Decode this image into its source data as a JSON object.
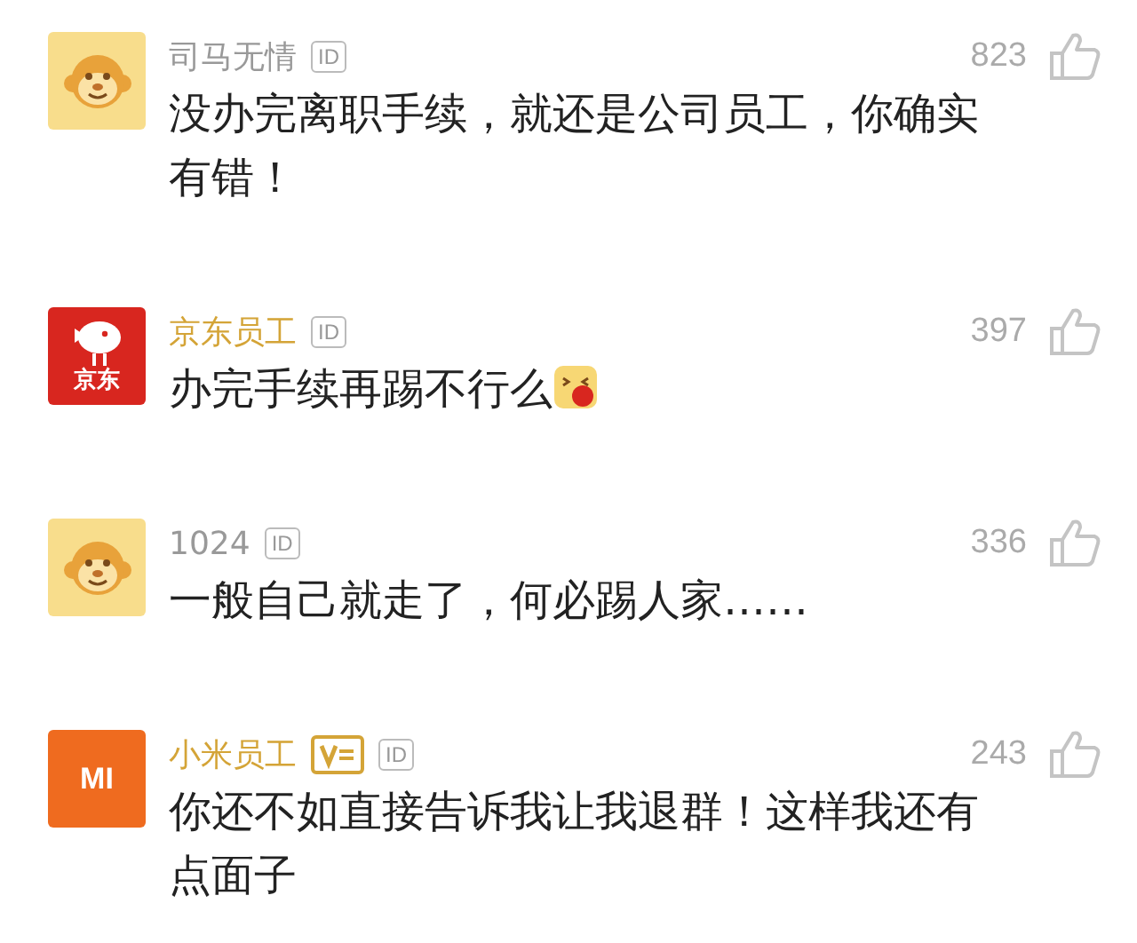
{
  "comments": [
    {
      "avatar": {
        "kind": "monkey"
      },
      "name": "司马无情",
      "highlighted": false,
      "vip": false,
      "id_badge": "ID",
      "likes": "823",
      "text": "没办完离职手续，就还是公司员工，你确实有错！",
      "emoji": false
    },
    {
      "avatar": {
        "kind": "jd",
        "text": "京东"
      },
      "name": "京东员工",
      "highlighted": true,
      "vip": false,
      "id_badge": "ID",
      "likes": "397",
      "text": "办完手续再踢不行么",
      "emoji": true
    },
    {
      "avatar": {
        "kind": "monkey"
      },
      "name": "1024",
      "highlighted": false,
      "vip": false,
      "id_badge": "ID",
      "likes": "336",
      "text": "一般自己就走了，何必踢人家……",
      "emoji": false
    },
    {
      "avatar": {
        "kind": "mi",
        "text": "MI"
      },
      "name": "小米员工",
      "highlighted": true,
      "vip": true,
      "id_badge": "ID",
      "likes": "243",
      "text": "你还不如直接告诉我让我退群！这样我还有点面子",
      "emoji": false
    }
  ]
}
